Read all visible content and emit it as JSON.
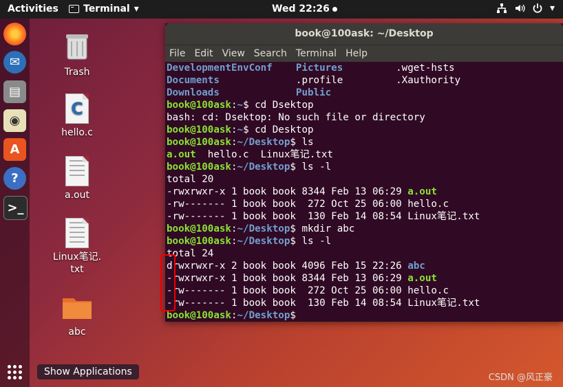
{
  "topbar": {
    "activities": "Activities",
    "app_name": "Terminal",
    "app_arrow": "▾",
    "clock": "Wed 22:26"
  },
  "tray": {
    "network": "network-icon",
    "volume": "volume-icon",
    "power": "power-icon",
    "arrow": "▾"
  },
  "desktop": {
    "icons": [
      {
        "label": "Trash"
      },
      {
        "label": "hello.c"
      },
      {
        "label": "a.out"
      },
      {
        "label": "Linux笔记.\ntxt"
      },
      {
        "label": "abc"
      }
    ]
  },
  "window": {
    "title": "book@100ask: ~/Desktop",
    "menu": [
      "File",
      "Edit",
      "View",
      "Search",
      "Terminal",
      "Help"
    ],
    "lines": [
      [
        {
          "t": "DevelopmentEnvConf    ",
          "c": "b"
        },
        {
          "t": "Pictures",
          "c": "b"
        },
        {
          "t": "         .wget-hsts",
          "c": "w"
        }
      ],
      [
        {
          "t": "Documents",
          "c": "b"
        },
        {
          "t": "             .profile",
          "c": "w"
        },
        {
          "t": "         .Xauthority",
          "c": "w"
        }
      ],
      [
        {
          "t": "Downloads",
          "c": "b"
        },
        {
          "t": "             ",
          "c": "w"
        },
        {
          "t": "Public",
          "c": "b"
        }
      ],
      [
        {
          "t": "book@100ask",
          "c": "g"
        },
        {
          "t": ":",
          "c": "w"
        },
        {
          "t": "~",
          "c": "b"
        },
        {
          "t": "$ cd Dsektop",
          "c": "w"
        }
      ],
      [
        {
          "t": "bash: cd: Dsektop: No such file or directory",
          "c": "w"
        }
      ],
      [
        {
          "t": "book@100ask",
          "c": "g"
        },
        {
          "t": ":",
          "c": "w"
        },
        {
          "t": "~",
          "c": "b"
        },
        {
          "t": "$ cd Desktop",
          "c": "w"
        }
      ],
      [
        {
          "t": "book@100ask",
          "c": "g"
        },
        {
          "t": ":",
          "c": "w"
        },
        {
          "t": "~/Desktop",
          "c": "b"
        },
        {
          "t": "$ ls",
          "c": "w"
        }
      ],
      [
        {
          "t": "a.out",
          "c": "g"
        },
        {
          "t": "  hello.c  Linux笔记.txt",
          "c": "w"
        }
      ],
      [
        {
          "t": "book@100ask",
          "c": "g"
        },
        {
          "t": ":",
          "c": "w"
        },
        {
          "t": "~/Desktop",
          "c": "b"
        },
        {
          "t": "$ ls -l",
          "c": "w"
        }
      ],
      [
        {
          "t": "total 20",
          "c": "w"
        }
      ],
      [
        {
          "t": "-rwxrwxr-x 1 book book 8344 Feb 13 06:29 ",
          "c": "w"
        },
        {
          "t": "a.out",
          "c": "g"
        }
      ],
      [
        {
          "t": "-rw------- 1 book book  272 Oct 25 06:00 hello.c",
          "c": "w"
        }
      ],
      [
        {
          "t": "-rw------- 1 book book  130 Feb 14 08:54 Linux笔记.txt",
          "c": "w"
        }
      ],
      [
        {
          "t": "book@100ask",
          "c": "g"
        },
        {
          "t": ":",
          "c": "w"
        },
        {
          "t": "~/Desktop",
          "c": "b"
        },
        {
          "t": "$ mkdir abc",
          "c": "w"
        }
      ],
      [
        {
          "t": "book@100ask",
          "c": "g"
        },
        {
          "t": ":",
          "c": "w"
        },
        {
          "t": "~/Desktop",
          "c": "b"
        },
        {
          "t": "$ ls -l",
          "c": "w"
        }
      ],
      [
        {
          "t": "total 24",
          "c": "w"
        }
      ],
      [
        {
          "t": "drwxrwxr-x 2 book book 4096 Feb 15 22:26 ",
          "c": "w"
        },
        {
          "t": "abc",
          "c": "b"
        }
      ],
      [
        {
          "t": "-rwxrwxr-x 1 book book 8344 Feb 13 06:29 ",
          "c": "w"
        },
        {
          "t": "a.out",
          "c": "g"
        }
      ],
      [
        {
          "t": "-rw------- 1 book book  272 Oct 25 06:00 hello.c",
          "c": "w"
        }
      ],
      [
        {
          "t": "-rw------- 1 book book  130 Feb 14 08:54 Linux笔记.txt",
          "c": "w"
        }
      ],
      [
        {
          "t": "book@100ask",
          "c": "g"
        },
        {
          "t": ":",
          "c": "w"
        },
        {
          "t": "~/Desktop",
          "c": "b"
        },
        {
          "t": "$",
          "c": "w"
        }
      ]
    ]
  },
  "bottom": {
    "show_applications": "Show Applications",
    "watermark": "CSDN @风正豪"
  },
  "colors": {
    "prompt_green": "#8ae234",
    "dir_blue": "#729fcf",
    "terminal_bg": "#300a24",
    "annotation_red": "#e00000"
  }
}
